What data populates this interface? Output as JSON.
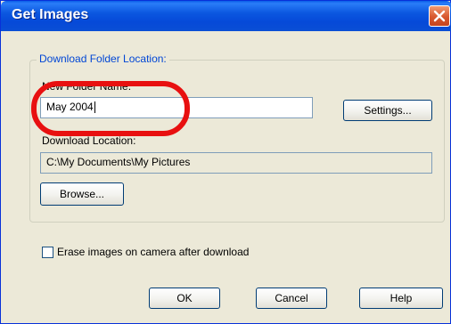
{
  "window": {
    "title": "Get Images",
    "close_icon": "close-icon"
  },
  "group": {
    "legend": "Download Folder Location:"
  },
  "new_folder": {
    "label": "New Folder Name:",
    "value": "May 2004"
  },
  "settings_button": "Settings...",
  "download_location": {
    "label": "Download Location:",
    "value": "C:\\My Documents\\My Pictures"
  },
  "browse_button": "Browse...",
  "erase_checkbox": {
    "label": "Erase images on camera after download",
    "checked": false
  },
  "buttons": {
    "ok": "OK",
    "cancel": "Cancel",
    "help": "Help"
  },
  "colors": {
    "titlebar": "#0b57e0",
    "group_legend": "#0046d5",
    "highlight": "#e81010",
    "dialog_bg": "#ece9d8"
  }
}
